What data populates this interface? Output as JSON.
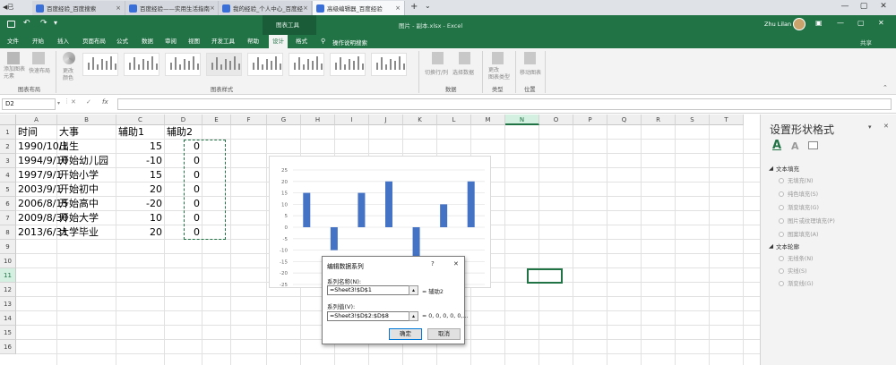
{
  "browser": {
    "tabs": [
      {
        "label": "百度经验_百度搜索"
      },
      {
        "label": "百度经验——实用生活指南"
      },
      {
        "label": "我的经验_个人中心_百度经"
      },
      {
        "label": "高级编辑器_百度经验"
      }
    ],
    "back_label": "◀已",
    "new_tab": "+",
    "dropdown": "⌄",
    "controls": [
      "—",
      "▢",
      "✕"
    ]
  },
  "excel": {
    "file_title": "图片 - 副本.xlsx  -  Excel",
    "chart_tools": "图表工具",
    "user_name": "Zhu Lilan",
    "share": "共享",
    "tabs": [
      "文件",
      "开始",
      "插入",
      "页面布局",
      "公式",
      "数据",
      "审阅",
      "视图",
      "开发工具",
      "帮助",
      "设计",
      "格式"
    ],
    "active_tab": "设计",
    "tell_me": "操作说明搜索",
    "ribbon": {
      "add_element": "添加图表\n元素",
      "quick_layout": "快速布局",
      "change_colors": "更改\n颜色",
      "switch_row_col": "切换行/列",
      "select_data": "选择数据",
      "change_type": "更改\n图表类型",
      "move_chart": "移动图表",
      "groups": [
        "图表布局",
        "图表样式",
        "数据",
        "类型",
        "位置"
      ]
    },
    "name_box": "D2",
    "formula_icons": [
      "✕",
      "✓",
      "fx"
    ],
    "columns": [
      "A",
      "B",
      "C",
      "D",
      "E",
      "F",
      "G",
      "H",
      "I",
      "J",
      "K",
      "L",
      "M",
      "N",
      "O",
      "P",
      "Q",
      "R",
      "S",
      "T"
    ],
    "rows": [
      "1",
      "2",
      "3",
      "4",
      "5",
      "6",
      "7",
      "8",
      "9",
      "10",
      "11",
      "12",
      "13",
      "14",
      "15",
      "16"
    ],
    "cells": {
      "header": [
        "时间",
        "大事",
        "辅助1",
        "辅助2"
      ],
      "data": [
        [
          "1990/10/1",
          "出生",
          "15",
          "0"
        ],
        [
          "1994/9/10",
          "开始幼儿园",
          "-10",
          "0"
        ],
        [
          "1997/9/1",
          "开始小学",
          "15",
          "0"
        ],
        [
          "2003/9/1",
          "开始初中",
          "20",
          "0"
        ],
        [
          "2006/8/15",
          "开始高中",
          "-20",
          "0"
        ],
        [
          "2009/8/30",
          "开始大学",
          "10",
          "0"
        ],
        [
          "2013/6/31",
          "大学毕业",
          "20",
          "0"
        ]
      ]
    }
  },
  "chart_data": {
    "type": "bar",
    "categories": [
      "1990/10/1",
      "1994/9/10",
      "1997/9/1",
      "2003/9/1",
      "2006/8/15",
      "2009/8/30",
      "2013/6/31"
    ],
    "series": [
      {
        "values": [
          15,
          -10,
          15,
          20,
          -20,
          10,
          20
        ]
      }
    ],
    "ylim": [
      -25,
      25
    ],
    "yticks": [
      25,
      20,
      15,
      10,
      5,
      0,
      -5,
      -10,
      -15,
      -20,
      -25
    ],
    "grid": true,
    "color": "#4472c4"
  },
  "pane": {
    "title": "设置形状格式",
    "close": "✕",
    "dropdown": "▾",
    "section_fill": "文本填充",
    "fill_options": [
      "无填充(N)",
      "纯色填充(S)",
      "渐变填充(G)",
      "图片或纹理填充(P)",
      "图案填充(A)"
    ],
    "section_outline": "文本轮廓",
    "outline_options": [
      "无线条(N)",
      "实线(S)",
      "渐变线(G)"
    ]
  },
  "dialog": {
    "title": "编辑数据系列",
    "help": "?",
    "close": "✕",
    "name_label": "系列名称(N):",
    "name_value": "=Sheet3!$D$1",
    "name_preview": "= 辅助2",
    "values_label": "系列值(V):",
    "values_value": "=Sheet3!$D$2:$D$8",
    "values_preview": "= 0, 0, 0, 0, 0,...",
    "ok": "确定",
    "cancel": "取消"
  },
  "colors": {
    "excel_green": "#217346",
    "bar_blue": "#4472c4"
  }
}
